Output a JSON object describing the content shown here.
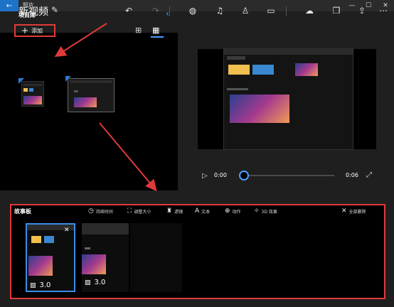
{
  "titlebar": {
    "app_name": "照片",
    "back_icon": "back-arrow-icon"
  },
  "header": {
    "project_title": "新视频"
  },
  "library": {
    "title": "项目库",
    "add_label": "添加"
  },
  "player": {
    "time_start": "0:00",
    "time_end": "0:06"
  },
  "storyboard": {
    "title": "故事板",
    "tools": [
      {
        "label": "持续时间",
        "icon": "clock-icon"
      },
      {
        "label": "调整大小",
        "icon": "resize-icon"
      },
      {
        "label": "滤镜",
        "icon": "filter-icon"
      },
      {
        "label": "文本",
        "icon": "text-icon"
      },
      {
        "label": "动作",
        "icon": "motion-icon"
      },
      {
        "label": "3D 效果",
        "icon": "effects-3d-icon"
      }
    ],
    "remove_all_label": "全部删除",
    "clips": [
      {
        "duration": "3.0"
      },
      {
        "duration": "3.0"
      }
    ]
  },
  "colors": {
    "accent": "#3a8ee6",
    "highlight": "#e03a3a"
  }
}
